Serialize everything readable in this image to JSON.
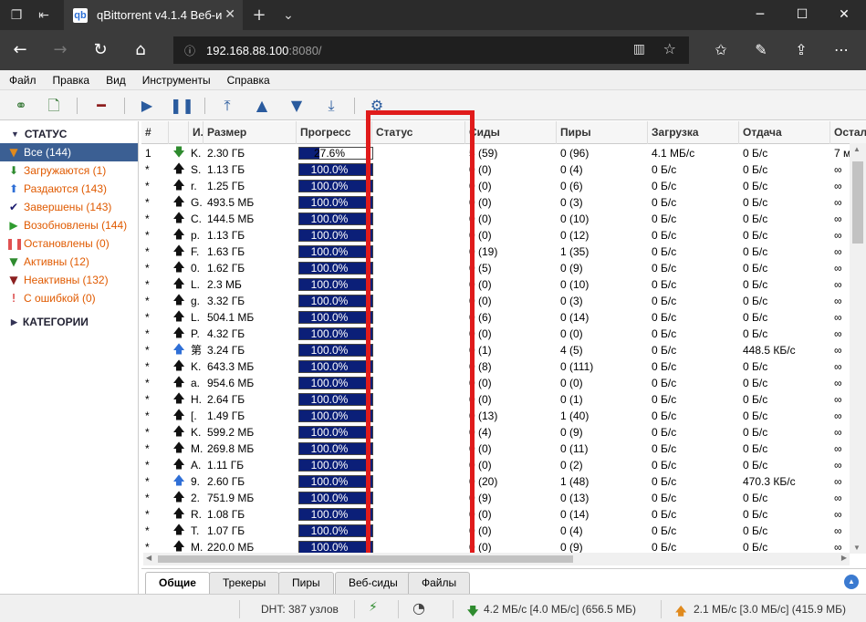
{
  "browser": {
    "tab_title": "qBittorrent v4.1.4 Веб-и",
    "url_host": "192.168.88.100",
    "url_port": ":8080/"
  },
  "menu": [
    "Файл",
    "Правка",
    "Вид",
    "Инструменты",
    "Справка"
  ],
  "sidebar": {
    "status_header": "СТАТУС",
    "items": [
      {
        "label": "Все (144)",
        "icon": "filter-icon",
        "color": "#e08a1e"
      },
      {
        "label": "Загружаются (1)",
        "icon": "download-arrow-icon",
        "color": "#2e8b2e"
      },
      {
        "label": "Раздаются (143)",
        "icon": "upload-arrow-icon",
        "color": "#2f6fd6"
      },
      {
        "label": "Завершены (143)",
        "icon": "checkmark-icon",
        "color": "#1a1a6e"
      },
      {
        "label": "Возобновлены (144)",
        "icon": "play-icon",
        "color": "#2e9b2e"
      },
      {
        "label": "Остановлены (0)",
        "icon": "pause-icon",
        "color": "#e05050"
      },
      {
        "label": "Активны (12)",
        "icon": "filter-icon",
        "color": "#2e8b2e"
      },
      {
        "label": "Неактивны (132)",
        "icon": "filter-icon",
        "color": "#8b2020"
      },
      {
        "label": "С ошибкой (0)",
        "icon": "error-icon",
        "color": "#d01010"
      }
    ],
    "categories_header": "КАТЕГОРИИ"
  },
  "table": {
    "columns": [
      "#",
      "",
      "И.",
      "Размер",
      "Прогресс",
      "Статус",
      "Сиды",
      "Пиры",
      "Загрузка",
      "Отдача",
      "Остал"
    ],
    "rows": [
      {
        "num": "1",
        "dir": "down",
        "name": "K.",
        "size": "2.30 ГБ",
        "progress": 0.276,
        "progress_label": "27.6%",
        "seeds": "5 (59)",
        "peers": "0 (96)",
        "dl": "4.1 МБ/с",
        "ul": "0 Б/с",
        "eta": "7 м"
      },
      {
        "num": "*",
        "dir": "up",
        "name": "S.",
        "size": "1.13 ГБ",
        "progress": 1,
        "progress_label": "100.0%",
        "seeds": "0 (0)",
        "peers": "0 (4)",
        "dl": "0 Б/с",
        "ul": "0 Б/с",
        "eta": "∞"
      },
      {
        "num": "*",
        "dir": "up",
        "name": "r.",
        "size": "1.25 ГБ",
        "progress": 1,
        "progress_label": "100.0%",
        "seeds": "0 (0)",
        "peers": "0 (6)",
        "dl": "0 Б/с",
        "ul": "0 Б/с",
        "eta": "∞"
      },
      {
        "num": "*",
        "dir": "up",
        "name": "G.",
        "size": "493.5 МБ",
        "progress": 1,
        "progress_label": "100.0%",
        "seeds": "0 (0)",
        "peers": "0 (3)",
        "dl": "0 Б/с",
        "ul": "0 Б/с",
        "eta": "∞"
      },
      {
        "num": "*",
        "dir": "up",
        "name": "C.",
        "size": "144.5 МБ",
        "progress": 1,
        "progress_label": "100.0%",
        "seeds": "0 (0)",
        "peers": "0 (10)",
        "dl": "0 Б/с",
        "ul": "0 Б/с",
        "eta": "∞"
      },
      {
        "num": "*",
        "dir": "up",
        "name": "p.",
        "size": "1.13 ГБ",
        "progress": 1,
        "progress_label": "100.0%",
        "seeds": "0 (0)",
        "peers": "0 (12)",
        "dl": "0 Б/с",
        "ul": "0 Б/с",
        "eta": "∞"
      },
      {
        "num": "*",
        "dir": "up",
        "name": "F.",
        "size": "1.63 ГБ",
        "progress": 1,
        "progress_label": "100.0%",
        "seeds": "0 (19)",
        "peers": "1 (35)",
        "dl": "0 Б/с",
        "ul": "0 Б/с",
        "eta": "∞"
      },
      {
        "num": "*",
        "dir": "up",
        "name": "0.",
        "size": "1.62 ГБ",
        "progress": 1,
        "progress_label": "100.0%",
        "seeds": "0 (5)",
        "peers": "0 (9)",
        "dl": "0 Б/с",
        "ul": "0 Б/с",
        "eta": "∞"
      },
      {
        "num": "*",
        "dir": "up",
        "name": "L.",
        "size": "2.3 МБ",
        "progress": 1,
        "progress_label": "100.0%",
        "seeds": "0 (0)",
        "peers": "0 (10)",
        "dl": "0 Б/с",
        "ul": "0 Б/с",
        "eta": "∞"
      },
      {
        "num": "*",
        "dir": "up",
        "name": "g.",
        "size": "3.32 ГБ",
        "progress": 1,
        "progress_label": "100.0%",
        "seeds": "0 (0)",
        "peers": "0 (3)",
        "dl": "0 Б/с",
        "ul": "0 Б/с",
        "eta": "∞"
      },
      {
        "num": "*",
        "dir": "up",
        "name": "L.",
        "size": "504.1 МБ",
        "progress": 1,
        "progress_label": "100.0%",
        "seeds": "0 (6)",
        "peers": "0 (14)",
        "dl": "0 Б/с",
        "ul": "0 Б/с",
        "eta": "∞"
      },
      {
        "num": "*",
        "dir": "up",
        "name": "P.",
        "size": "4.32 ГБ",
        "progress": 1,
        "progress_label": "100.0%",
        "seeds": "0 (0)",
        "peers": "0 (0)",
        "dl": "0 Б/с",
        "ul": "0 Б/с",
        "eta": "∞"
      },
      {
        "num": "*",
        "dir": "up-blue",
        "name": "第",
        "size": "3.24 ГБ",
        "progress": 1,
        "progress_label": "100.0%",
        "seeds": "0 (1)",
        "peers": "4 (5)",
        "dl": "0 Б/с",
        "ul": "448.5 КБ/с",
        "eta": "∞"
      },
      {
        "num": "*",
        "dir": "up",
        "name": "K.",
        "size": "643.3 МБ",
        "progress": 1,
        "progress_label": "100.0%",
        "seeds": "0 (8)",
        "peers": "0 (111)",
        "dl": "0 Б/с",
        "ul": "0 Б/с",
        "eta": "∞"
      },
      {
        "num": "*",
        "dir": "up",
        "name": "a.",
        "size": "954.6 МБ",
        "progress": 1,
        "progress_label": "100.0%",
        "seeds": "0 (0)",
        "peers": "0 (0)",
        "dl": "0 Б/с",
        "ul": "0 Б/с",
        "eta": "∞"
      },
      {
        "num": "*",
        "dir": "up",
        "name": "H.",
        "size": "2.64 ГБ",
        "progress": 1,
        "progress_label": "100.0%",
        "seeds": "0 (0)",
        "peers": "0 (1)",
        "dl": "0 Б/с",
        "ul": "0 Б/с",
        "eta": "∞"
      },
      {
        "num": "*",
        "dir": "up",
        "name": "[.",
        "size": "1.49 ГБ",
        "progress": 1,
        "progress_label": "100.0%",
        "seeds": "0 (13)",
        "peers": "1 (40)",
        "dl": "0 Б/с",
        "ul": "0 Б/с",
        "eta": "∞"
      },
      {
        "num": "*",
        "dir": "up",
        "name": "K.",
        "size": "599.2 МБ",
        "progress": 1,
        "progress_label": "100.0%",
        "seeds": "0 (4)",
        "peers": "0 (9)",
        "dl": "0 Б/с",
        "ul": "0 Б/с",
        "eta": "∞"
      },
      {
        "num": "*",
        "dir": "up",
        "name": "M.",
        "size": "269.8 МБ",
        "progress": 1,
        "progress_label": "100.0%",
        "seeds": "0 (0)",
        "peers": "0 (11)",
        "dl": "0 Б/с",
        "ul": "0 Б/с",
        "eta": "∞"
      },
      {
        "num": "*",
        "dir": "up",
        "name": "A.",
        "size": "1.11 ГБ",
        "progress": 1,
        "progress_label": "100.0%",
        "seeds": "0 (0)",
        "peers": "0 (2)",
        "dl": "0 Б/с",
        "ul": "0 Б/с",
        "eta": "∞"
      },
      {
        "num": "*",
        "dir": "up-blue",
        "name": "9.",
        "size": "2.60 ГБ",
        "progress": 1,
        "progress_label": "100.0%",
        "seeds": "0 (20)",
        "peers": "1 (48)",
        "dl": "0 Б/с",
        "ul": "470.3 КБ/с",
        "eta": "∞"
      },
      {
        "num": "*",
        "dir": "up",
        "name": "2.",
        "size": "751.9 МБ",
        "progress": 1,
        "progress_label": "100.0%",
        "seeds": "0 (9)",
        "peers": "0 (13)",
        "dl": "0 Б/с",
        "ul": "0 Б/с",
        "eta": "∞"
      },
      {
        "num": "*",
        "dir": "up",
        "name": "R.",
        "size": "1.08 ГБ",
        "progress": 1,
        "progress_label": "100.0%",
        "seeds": "0 (0)",
        "peers": "0 (14)",
        "dl": "0 Б/с",
        "ul": "0 Б/с",
        "eta": "∞"
      },
      {
        "num": "*",
        "dir": "up",
        "name": "T.",
        "size": "1.07 ГБ",
        "progress": 1,
        "progress_label": "100.0%",
        "seeds": "0 (0)",
        "peers": "0 (4)",
        "dl": "0 Б/с",
        "ul": "0 Б/с",
        "eta": "∞"
      },
      {
        "num": "*",
        "dir": "up",
        "name": "M.",
        "size": "220.0 МБ",
        "progress": 1,
        "progress_label": "100.0%",
        "seeds": "0 (0)",
        "peers": "0 (9)",
        "dl": "0 Б/с",
        "ul": "0 Б/с",
        "eta": "∞"
      }
    ]
  },
  "bottom_tabs": [
    "Общие",
    "Трекеры",
    "Пиры",
    "Веб-сиды",
    "Файлы"
  ],
  "statusbar": {
    "dht": "DHT: 387 узлов",
    "download": "4.2 МБ/с [4.0 МБ/с] (656.5 МБ)",
    "upload": "2.1 МБ/с [3.0 МБ/с] (415.9 МБ)"
  },
  "colors": {
    "highlight_box": "#e01b1b",
    "progress_fill": "#0b1f78",
    "selected_filter": "#3b5f93"
  }
}
